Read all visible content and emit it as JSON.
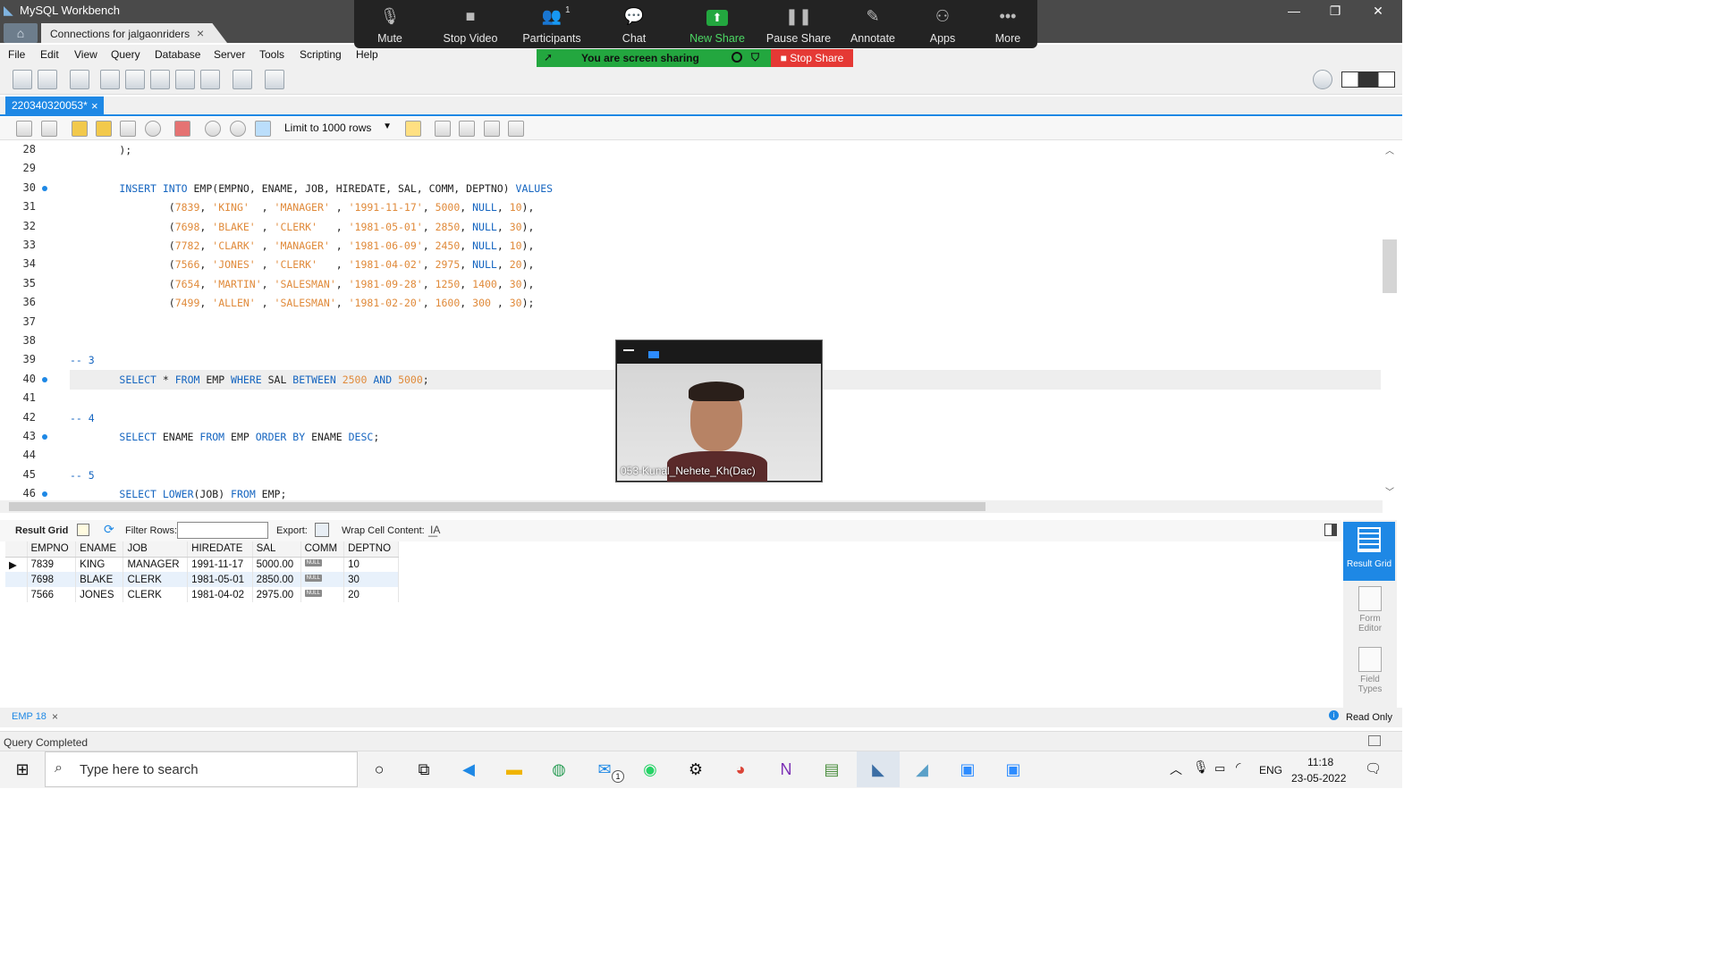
{
  "window": {
    "title": "MySQL Workbench"
  },
  "connection_tab": {
    "label": "Connections for jalgaonriders"
  },
  "menu": [
    "File",
    "Edit",
    "View",
    "Query",
    "Database",
    "Server",
    "Tools",
    "Scripting",
    "Help"
  ],
  "sql_tab": {
    "label": "220340320053*"
  },
  "limit_select": {
    "value": "Limit to 1000 rows"
  },
  "editor": {
    "lines": [
      {
        "n": "28",
        "text": "        );"
      },
      {
        "n": "29",
        "text": ""
      },
      {
        "n": "30",
        "text": "        INSERT INTO EMP(EMPNO, ENAME, JOB, HIREDATE, SAL, COMM, DEPTNO) VALUES"
      },
      {
        "n": "31",
        "text": "                (7839, 'KING'  , 'MANAGER' , '1991-11-17', 5000, NULL, 10),"
      },
      {
        "n": "32",
        "text": "                (7698, 'BLAKE' , 'CLERK'   , '1981-05-01', 2850, NULL, 30),"
      },
      {
        "n": "33",
        "text": "                (7782, 'CLARK' , 'MANAGER' , '1981-06-09', 2450, NULL, 10),"
      },
      {
        "n": "34",
        "text": "                (7566, 'JONES' , 'CLERK'   , '1981-04-02', 2975, NULL, 20),"
      },
      {
        "n": "35",
        "text": "                (7654, 'MARTIN', 'SALESMAN', '1981-09-28', 1250, 1400, 30),"
      },
      {
        "n": "36",
        "text": "                (7499, 'ALLEN' , 'SALESMAN', '1981-02-20', 1600, 300 , 30);"
      },
      {
        "n": "37",
        "text": ""
      },
      {
        "n": "38",
        "text": ""
      },
      {
        "n": "39",
        "text": "-- 3"
      },
      {
        "n": "40",
        "text": "        SELECT * FROM EMP WHERE SAL BETWEEN 2500 AND 5000;"
      },
      {
        "n": "41",
        "text": ""
      },
      {
        "n": "42",
        "text": "-- 4"
      },
      {
        "n": "43",
        "text": "        SELECT ENAME FROM EMP ORDER BY ENAME DESC;"
      },
      {
        "n": "44",
        "text": ""
      },
      {
        "n": "45",
        "text": "-- 5"
      },
      {
        "n": "46",
        "text": "        SELECT LOWER(JOB) FROM EMP;"
      }
    ]
  },
  "result_toolbar": {
    "result_grid": "Result Grid",
    "filter_rows": "Filter Rows:",
    "export": "Export:",
    "wrap": "Wrap Cell Content:"
  },
  "result": {
    "columns": [
      "EMPNO",
      "ENAME",
      "JOB",
      "HIREDATE",
      "SAL",
      "COMM",
      "DEPTNO"
    ],
    "rows": [
      [
        "7839",
        "KING",
        "MANAGER",
        "1991-11-17",
        "5000.00",
        "NULL",
        "10"
      ],
      [
        "7698",
        "BLAKE",
        "CLERK",
        "1981-05-01",
        "2850.00",
        "NULL",
        "30"
      ],
      [
        "7566",
        "JONES",
        "CLERK",
        "1981-04-02",
        "2975.00",
        "NULL",
        "20"
      ]
    ]
  },
  "side_panel": {
    "result_grid": "Result Grid",
    "form_editor": "Form Editor",
    "field_types": "Field Types"
  },
  "bottom_tab": {
    "label": "EMP 18",
    "read_only": "Read Only"
  },
  "status": {
    "text": "Query Completed"
  },
  "zoom": {
    "buttons": [
      {
        "label": "Mute",
        "icon": "microphone-icon"
      },
      {
        "label": "Stop Video",
        "icon": "video-camera-icon"
      },
      {
        "label": "Participants",
        "icon": "participants-icon",
        "count": "1"
      },
      {
        "label": "Chat",
        "icon": "chat-icon"
      },
      {
        "label": "New Share",
        "icon": "share-icon"
      },
      {
        "label": "Pause Share",
        "icon": "pause-icon"
      },
      {
        "label": "Annotate",
        "icon": "pencil-icon"
      },
      {
        "label": "Apps",
        "icon": "apps-icon"
      },
      {
        "label": "More",
        "icon": "more-icon"
      }
    ],
    "sharing_text": "You are screen sharing",
    "stop_share": "Stop Share",
    "participant_name": "053-Kunal_Nehete_Kh(Dac)"
  },
  "taskbar": {
    "search_placeholder": "Type here to search",
    "lang": "ENG",
    "time": "11:18",
    "date": "23-05-2022",
    "mail_badge": "1"
  },
  "colors": {
    "accent": "#1e88e5",
    "zoom_green": "#23a73f",
    "stop_red": "#e53935"
  }
}
